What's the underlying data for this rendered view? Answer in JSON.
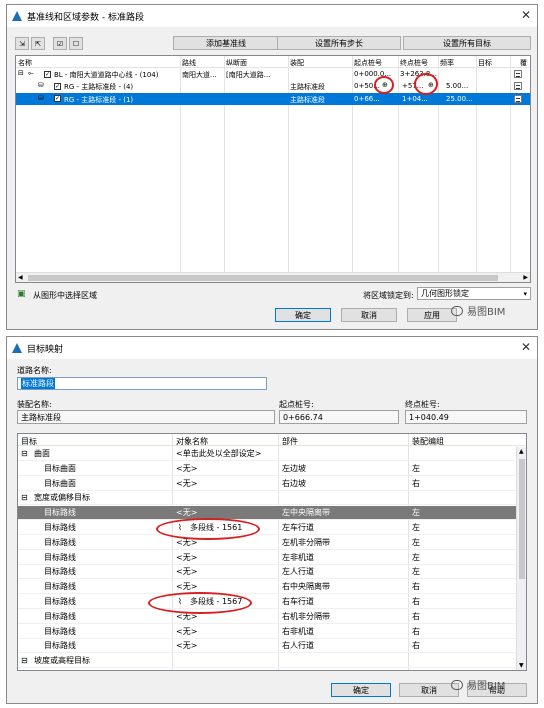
{
  "dlg1": {
    "title": "基准线和区域参数 - 标准路段",
    "add_baseline": "添加基准线",
    "set_all_steps": "设置所有步长",
    "set_all_targets": "设置所有目标",
    "columns": [
      "名称",
      "路线",
      "纵断面",
      "装配",
      "起点桩号",
      "终点桩号",
      "频率",
      "目标",
      "覆"
    ],
    "rows": [
      {
        "name": "BL - 南阳大道道路中心线 - (104)",
        "alignment": "南阳大道...",
        "profile": "[南阳大道路...",
        "assembly": "",
        "start": "0+000.0...",
        "end": "3+263.8...",
        "freq": "",
        "checked": true
      },
      {
        "name": "RG - 主路标准段 - (4)",
        "alignment": "",
        "profile": "",
        "assembly": "主路标准段",
        "start": "0+50...",
        "end": "+57...",
        "freq": "5.00...",
        "checked": true
      },
      {
        "name": "RG - 主路标准段 - (1)",
        "alignment": "",
        "profile": "",
        "assembly": "主路标准段",
        "start": "0+66...",
        "end": "1+04...",
        "freq": "25.00...",
        "checked": true
      }
    ],
    "select_region": "从图形中选择区域",
    "lock_label": "将区域锁定到:",
    "lock_value": "几何图形锁定",
    "ok": "确定",
    "cancel": "取消",
    "apply": "应用",
    "watermark": "易图BIM"
  },
  "dlg2": {
    "title": "目标映射",
    "road_name_label": "道路名称:",
    "road_name": "标准路段",
    "assembly_label": "装配名称:",
    "assembly": "主路标准段",
    "start_label": "起点桩号:",
    "start": "0+666.74",
    "end_label": "终点桩号:",
    "end": "1+040.49",
    "columns": [
      "目标",
      "对象名称",
      "部件",
      "装配编组"
    ],
    "rows": [
      {
        "t": "曲面",
        "o": "<单击此处以全部设定>",
        "p": "",
        "g": "",
        "group": true
      },
      {
        "t": "目标曲面",
        "o": "<无>",
        "p": "左边坡",
        "g": "左"
      },
      {
        "t": "目标曲面",
        "o": "<无>",
        "p": "右边坡",
        "g": "右"
      },
      {
        "t": "宽度或偏移目标",
        "o": "",
        "p": "",
        "g": "",
        "group": true
      },
      {
        "t": "目标路线",
        "o": "<无>",
        "p": "左中央隔离带",
        "g": "左",
        "sel": true
      },
      {
        "t": "目标路线",
        "o": "多段线 - 1561",
        "p": "左车行道",
        "g": "左"
      },
      {
        "t": "目标路线",
        "o": "<无>",
        "p": "左机非分隔带",
        "g": "左"
      },
      {
        "t": "目标路线",
        "o": "<无>",
        "p": "左非机道",
        "g": "左"
      },
      {
        "t": "目标路线",
        "o": "<无>",
        "p": "左人行道",
        "g": "左"
      },
      {
        "t": "目标路线",
        "o": "<无>",
        "p": "右中央隔离带",
        "g": "右"
      },
      {
        "t": "目标路线",
        "o": "多段线 - 1567",
        "p": "右车行道",
        "g": "右"
      },
      {
        "t": "目标路线",
        "o": "<无>",
        "p": "右机非分隔带",
        "g": "右"
      },
      {
        "t": "目标路线",
        "o": "<无>",
        "p": "右非机道",
        "g": "右"
      },
      {
        "t": "目标路线",
        "o": "<无>",
        "p": "右人行道",
        "g": "右"
      },
      {
        "t": "坡度或高程目标",
        "o": "",
        "p": "",
        "g": "",
        "group": true
      }
    ],
    "ok": "确定",
    "cancel": "取消",
    "help": "帮助",
    "watermark": "易图BIM"
  },
  "colors": {
    "selection": "#0078d7",
    "highlight_row": "#7a7a7a",
    "annotation_red": "#d81e1e"
  }
}
